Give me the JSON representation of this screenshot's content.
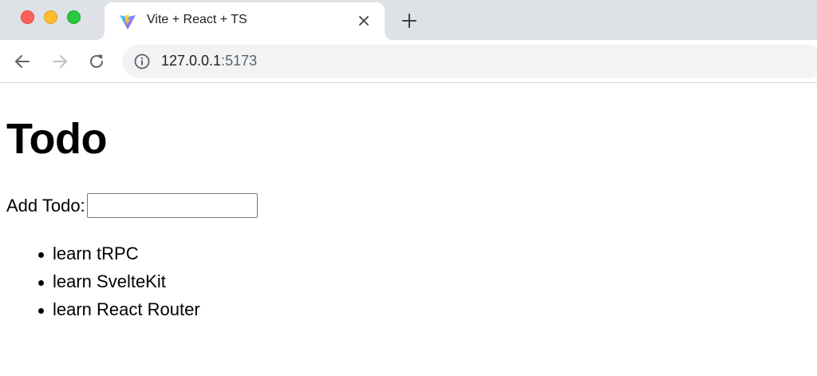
{
  "browser": {
    "tab": {
      "title": "Vite + React + TS",
      "favicon": "vite-logo-icon",
      "close_icon": "close-icon"
    },
    "new_tab_icon": "plus-icon",
    "nav": {
      "back_icon": "back-arrow-icon",
      "forward_icon": "forward-arrow-icon",
      "reload_icon": "reload-icon"
    },
    "address_bar": {
      "icon": "info-icon",
      "host": "127.0.0.1",
      "port": ":5173"
    },
    "colors": {
      "tabstrip_bg": "#dee1e6",
      "omnibox_bg": "#f1f3f4",
      "close_red": "#fe5f57",
      "minimize_yellow": "#febc2e",
      "maximize_green": "#28c840"
    }
  },
  "page": {
    "title": "Todo",
    "add_todo": {
      "label": "Add Todo:",
      "value": "",
      "placeholder": ""
    },
    "todos": [
      {
        "text": "learn tRPC"
      },
      {
        "text": "learn SvelteKit"
      },
      {
        "text": "learn React Router"
      }
    ]
  }
}
